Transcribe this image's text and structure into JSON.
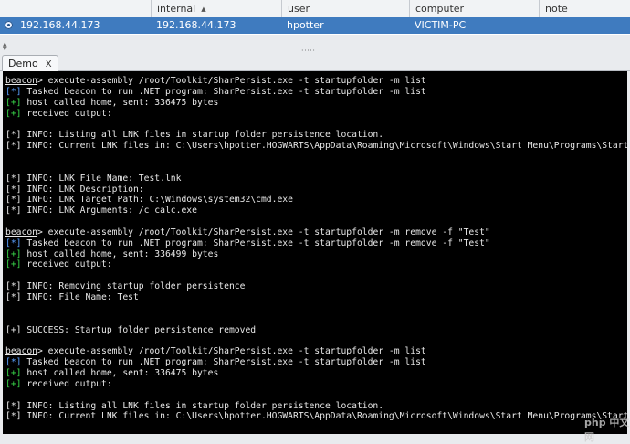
{
  "sessions": {
    "columns": [
      {
        "id": "external",
        "label": ""
      },
      {
        "id": "internal",
        "label": "internal",
        "sort": "▲"
      },
      {
        "id": "user",
        "label": "user"
      },
      {
        "id": "computer",
        "label": "computer"
      },
      {
        "id": "note",
        "label": "note"
      }
    ],
    "row": {
      "external": "192.168.44.173",
      "internal": "192.168.44.173",
      "user": "hpotter",
      "computer": "VICTIM-PC",
      "note": ""
    }
  },
  "tab": {
    "label": "Demo",
    "close": "X"
  },
  "watermark": "php 中文网",
  "colors": {
    "info": "#5aa0ff",
    "ok": "#39d94a",
    "selected_row": "#3f7bbf"
  },
  "console": {
    "lines": [
      {
        "type": "prompt",
        "prompt": "beacon",
        "text": "> execute-assembly /root/Toolkit/SharPersist.exe -t startupfolder -m list"
      },
      {
        "type": "info",
        "prefix": "[*]",
        "text": " Tasked beacon to run .NET program: SharPersist.exe -t startupfolder -m list"
      },
      {
        "type": "ok",
        "prefix": "[+]",
        "text": " host called home, sent: 336475 bytes"
      },
      {
        "type": "ok",
        "prefix": "[+]",
        "text": " received output:"
      },
      {
        "type": "blank"
      },
      {
        "type": "plain",
        "prefix": "[*]",
        "text": " INFO: Listing all LNK files in startup folder persistence location."
      },
      {
        "type": "plain",
        "prefix": "[*]",
        "text": " INFO: Current LNK files in: C:\\Users\\hpotter.HOGWARTS\\AppData\\Roaming\\Microsoft\\Windows\\Start Menu\\Programs\\Startup\\"
      },
      {
        "type": "blank"
      },
      {
        "type": "blank"
      },
      {
        "type": "plain",
        "prefix": "[*]",
        "text": " INFO: LNK File Name: Test.lnk"
      },
      {
        "type": "plain",
        "prefix": "[*]",
        "text": " INFO: LNK Description:"
      },
      {
        "type": "plain",
        "prefix": "[*]",
        "text": " INFO: LNK Target Path: C:\\Windows\\system32\\cmd.exe"
      },
      {
        "type": "plain",
        "prefix": "[*]",
        "text": " INFO: LNK Arguments: /c calc.exe"
      },
      {
        "type": "blank"
      },
      {
        "type": "prompt",
        "prompt": "beacon",
        "text": "> execute-assembly /root/Toolkit/SharPersist.exe -t startupfolder -m remove -f \"Test\""
      },
      {
        "type": "info",
        "prefix": "[*]",
        "text": " Tasked beacon to run .NET program: SharPersist.exe -t startupfolder -m remove -f \"Test\""
      },
      {
        "type": "ok",
        "prefix": "[+]",
        "text": " host called home, sent: 336499 bytes"
      },
      {
        "type": "ok",
        "prefix": "[+]",
        "text": " received output:"
      },
      {
        "type": "blank"
      },
      {
        "type": "plain",
        "prefix": "[*]",
        "text": " INFO: Removing startup folder persistence"
      },
      {
        "type": "plain",
        "prefix": "[*]",
        "text": " INFO: File Name: Test"
      },
      {
        "type": "blank"
      },
      {
        "type": "blank"
      },
      {
        "type": "plain",
        "prefix": "[+]",
        "text": " SUCCESS: Startup folder persistence removed"
      },
      {
        "type": "blank"
      },
      {
        "type": "prompt",
        "prompt": "beacon",
        "text": "> execute-assembly /root/Toolkit/SharPersist.exe -t startupfolder -m list"
      },
      {
        "type": "info",
        "prefix": "[*]",
        "text": " Tasked beacon to run .NET program: SharPersist.exe -t startupfolder -m list"
      },
      {
        "type": "ok",
        "prefix": "[+]",
        "text": " host called home, sent: 336475 bytes"
      },
      {
        "type": "ok",
        "prefix": "[+]",
        "text": " received output:"
      },
      {
        "type": "blank"
      },
      {
        "type": "plain",
        "prefix": "[*]",
        "text": " INFO: Listing all LNK files in startup folder persistence location."
      },
      {
        "type": "plain",
        "prefix": "[*]",
        "text": " INFO: Current LNK files in: C:\\Users\\hpotter.HOGWARTS\\AppData\\Roaming\\Microsoft\\Windows\\Start Menu\\Programs\\Startup\\"
      }
    ]
  }
}
